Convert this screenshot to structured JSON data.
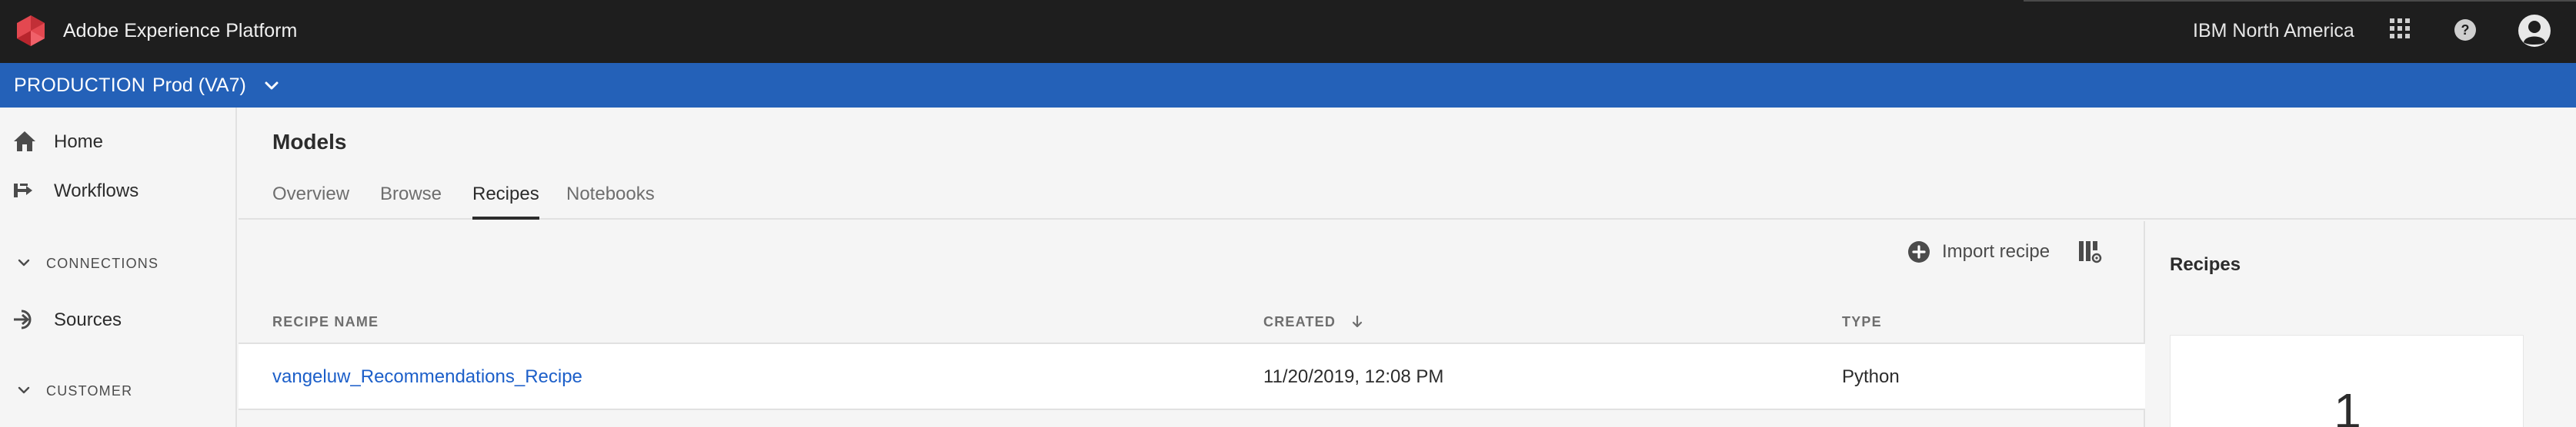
{
  "topbar": {
    "app_title": "Adobe Experience Platform",
    "org_name": "IBM North America",
    "icons": [
      "adobe-logo-icon",
      "apps-grid-icon",
      "help-icon",
      "user-avatar-icon"
    ],
    "brand_color": "#e34850"
  },
  "sandbox": {
    "environment": "PRODUCTION",
    "name": "Prod (VA7)",
    "bar_color": "#2461b8"
  },
  "sidebar": {
    "items": [
      {
        "label": "Home",
        "icon": "home-icon"
      },
      {
        "label": "Workflows",
        "icon": "workflows-icon"
      }
    ],
    "groups": [
      {
        "label": "CONNECTIONS"
      },
      {
        "label": "CUSTOMER"
      }
    ],
    "connections_items": [
      {
        "label": "Sources",
        "icon": "sources-icon"
      }
    ]
  },
  "main": {
    "title": "Models",
    "tabs": [
      {
        "label": "Overview",
        "active": false
      },
      {
        "label": "Browse",
        "active": false
      },
      {
        "label": "Recipes",
        "active": true
      },
      {
        "label": "Notebooks",
        "active": false
      }
    ]
  },
  "table": {
    "import_label": "Import recipe",
    "columns": [
      "RECIPE NAME",
      "CREATED",
      "TYPE"
    ],
    "sorted_column": "CREATED",
    "sort_direction": "descending",
    "rows": [
      {
        "name": "vangeluw_Recommendations_Recipe",
        "created": "11/20/2019, 12:08 PM",
        "type": "Python"
      }
    ]
  },
  "rail": {
    "title": "Recipes",
    "count": "1"
  }
}
